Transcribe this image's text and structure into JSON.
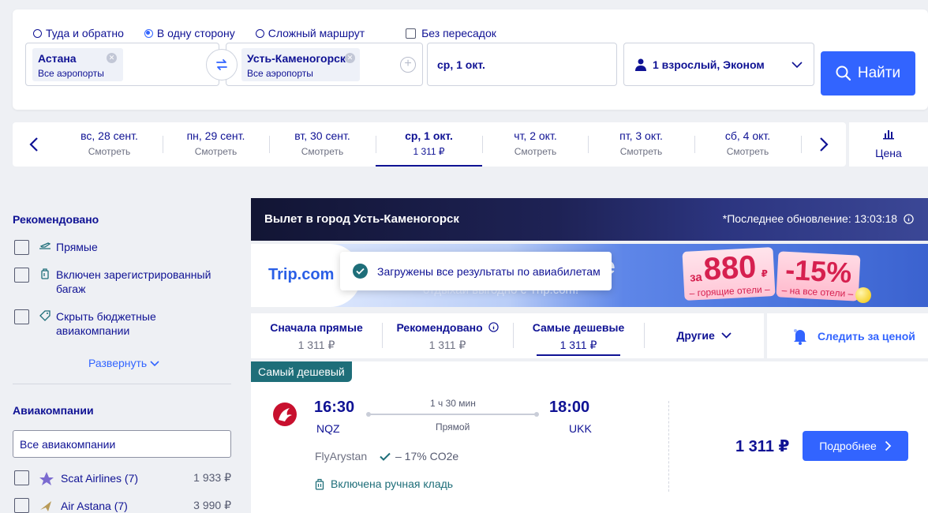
{
  "search": {
    "trip_types": [
      "Туда и обратно",
      "В одну сторону",
      "Сложный маршрут"
    ],
    "selected_trip_type": 1,
    "nonstop_label": "Без пересадок",
    "origin": {
      "city": "Астана",
      "sub": "Все аэропорты"
    },
    "destination": {
      "city": "Усть-Каменогорск",
      "sub": "Все аэропорты"
    },
    "date": "ср, 1 окт.",
    "passengers": "1 взрослый, Эконом",
    "search_button": "Найти"
  },
  "date_bar": {
    "days": [
      {
        "date": "вс, 28 сент.",
        "sub": "Смотреть"
      },
      {
        "date": "пн, 29 сент.",
        "sub": "Смотреть"
      },
      {
        "date": "вт, 30 сент.",
        "sub": "Смотреть"
      },
      {
        "date": "ср, 1 окт.",
        "sub": "1 311 ₽"
      },
      {
        "date": "чт, 2 окт.",
        "sub": "Смотреть"
      },
      {
        "date": "пт, 3 окт.",
        "sub": "Смотреть"
      },
      {
        "date": "сб, 4 окт.",
        "sub": "Смотреть"
      }
    ],
    "selected_index": 3,
    "price_label": "Цена"
  },
  "sidebar": {
    "recommended_title": "Рекомендовано",
    "recommended": [
      "Прямые",
      "Включен зарегистрированный багаж",
      "Скрыть бюджетные авиакомпании"
    ],
    "expand_label": "Развернуть",
    "airlines_title": "Авиакомпании",
    "airlines_input_value": "Все авиакомпании",
    "airlines": [
      {
        "name": "Scat Airlines (7)",
        "price": "1 933 ₽"
      },
      {
        "name": "Air Astana (7)",
        "price": "3 990 ₽"
      }
    ]
  },
  "results": {
    "header_title": "Вылет в город Усть-Каменогорск",
    "last_update": "*Последнее обновление: 13:03:18",
    "promo": {
      "brand": "Trip.com",
      "subtitle": "отдыхай выгодно с Trip.com!",
      "big_e": "e",
      "badge1_prefix": "за",
      "badge1_value": "880",
      "badge1_currency": "₽",
      "badge1_text": "– горящие отели –",
      "badge2_value": "-15%",
      "badge2_text": "– на все отели –"
    },
    "toast": "Загружены все результаты по авиабилетам",
    "sort_tabs": [
      {
        "label": "Сначала прямые",
        "price": "1 311 ₽"
      },
      {
        "label": "Рекомендовано",
        "price": "1 311 ₽"
      },
      {
        "label": "Самые дешевые",
        "price": "1 311 ₽"
      }
    ],
    "sort_selected": 2,
    "other_label": "Другие",
    "track_price_label": "Следить за ценой"
  },
  "flight": {
    "badge": "Самый дешевый",
    "depart_time": "16:30",
    "depart_iata": "NQZ",
    "arrive_time": "18:00",
    "arrive_iata": "UKK",
    "duration": "1 ч 30 мин",
    "stops": "Прямой",
    "carrier": "FlyArystan",
    "co2": "– 17% CO2e",
    "baggage": "Включена ручная кладь",
    "price": "1 311 ₽",
    "details_button": "Подробнее"
  },
  "colors": {
    "primary": "#3264ff",
    "text": "#0f1294",
    "teal": "#1e6e79",
    "promo_red": "#d6204f"
  }
}
